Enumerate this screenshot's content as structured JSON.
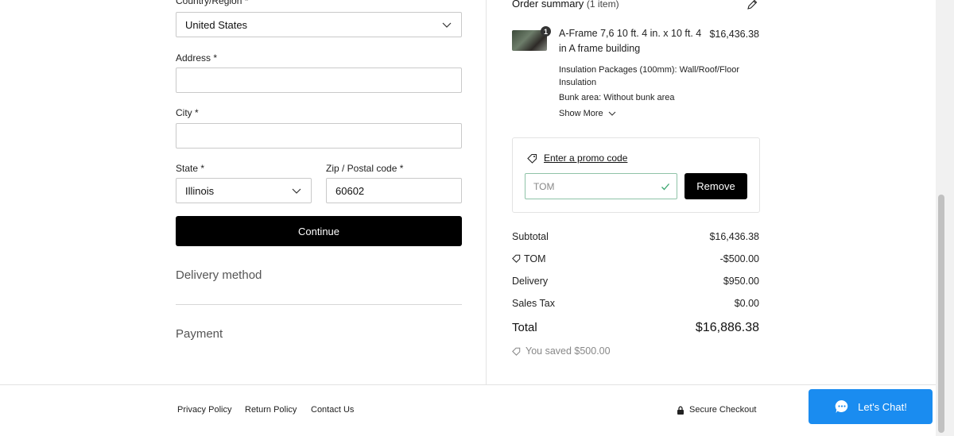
{
  "shipping_form": {
    "country_label": "Country/Region *",
    "country_value": "United States",
    "address_label": "Address *",
    "address_value": "",
    "city_label": "City *",
    "city_value": "",
    "state_label": "State *",
    "state_value": "Illinois",
    "zip_label": "Zip / Postal code *",
    "zip_value": "60602",
    "continue_label": "Continue"
  },
  "sections": {
    "delivery_method": "Delivery method",
    "payment": "Payment"
  },
  "order_summary": {
    "title": "Order summary",
    "count": "(1 item)",
    "item": {
      "quantity": "1",
      "name": "A-Frame 7,6 10 ft. 4 in. x 10 ft. 4 in A frame building",
      "price": "$16,436.38",
      "options": [
        "Insulation Packages (100mm): Wall/Roof/Floor Insulation",
        "Bunk area: Without bunk area"
      ],
      "show_more": "Show More"
    },
    "promo": {
      "link": "Enter a promo code",
      "code": "TOM",
      "remove_label": "Remove"
    },
    "totals": {
      "subtotal_label": "Subtotal",
      "subtotal_value": "$16,436.38",
      "discount_label": "TOM",
      "discount_value": "-$500.00",
      "delivery_label": "Delivery",
      "delivery_value": "$950.00",
      "tax_label": "Sales Tax",
      "tax_value": "$0.00",
      "total_label": "Total",
      "total_value": "$16,886.38",
      "saved": "You saved $500.00"
    }
  },
  "footer": {
    "privacy": "Privacy Policy",
    "return": "Return Policy",
    "contact": "Contact Us",
    "secure": "Secure Checkout"
  },
  "chat": {
    "label": "Let's Chat!"
  },
  "colors": {
    "chat_blue": "#1a8cf0",
    "button_black": "#000000",
    "promo_valid_green": "#8fc3a8"
  }
}
